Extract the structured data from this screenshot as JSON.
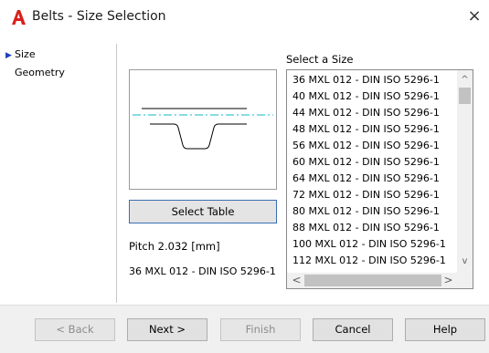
{
  "window": {
    "title": "Belts - Size Selection",
    "close_glyph": "×"
  },
  "nav": {
    "items": [
      {
        "label": "Size",
        "selected": true
      },
      {
        "label": "Geometry",
        "selected": false
      }
    ],
    "selected_marker": "▶"
  },
  "preview": {
    "select_table_label": "Select Table"
  },
  "info": {
    "pitch": "Pitch 2.032 [mm]",
    "selected_size": "36 MXL 012 - DIN ISO 5296-1"
  },
  "size_list": {
    "label": "Select a Size",
    "items": [
      "36 MXL 012 - DIN ISO 5296-1",
      "40 MXL 012 - DIN ISO 5296-1",
      "44 MXL 012 - DIN ISO 5296-1",
      "48 MXL 012 - DIN ISO 5296-1",
      "56 MXL 012 - DIN ISO 5296-1",
      "60 MXL 012 - DIN ISO 5296-1",
      "64 MXL 012 - DIN ISO 5296-1",
      "72 MXL 012 - DIN ISO 5296-1",
      "80 MXL 012 - DIN ISO 5296-1",
      "88 MXL 012 - DIN ISO 5296-1",
      "100 MXL 012 - DIN ISO 5296-1",
      "112 MXL 012 - DIN ISO 5296-1"
    ],
    "selected_index": 0,
    "scroll_up_glyph": "^",
    "scroll_down_glyph": "v",
    "scroll_left_glyph": "<",
    "scroll_right_glyph": ">"
  },
  "footer": {
    "back_label": "< Back",
    "next_label": "Next >",
    "finish_label": "Finish",
    "cancel_label": "Cancel",
    "help_label": "Help"
  },
  "colors": {
    "app_icon": "#d9201c",
    "nav_marker": "#1f3fbf",
    "belt_centerline": "#3fc6d6",
    "button_focus_border": "#3a6fb3"
  },
  "icons": {
    "app": "autocad-a-icon",
    "close": "close-icon"
  }
}
